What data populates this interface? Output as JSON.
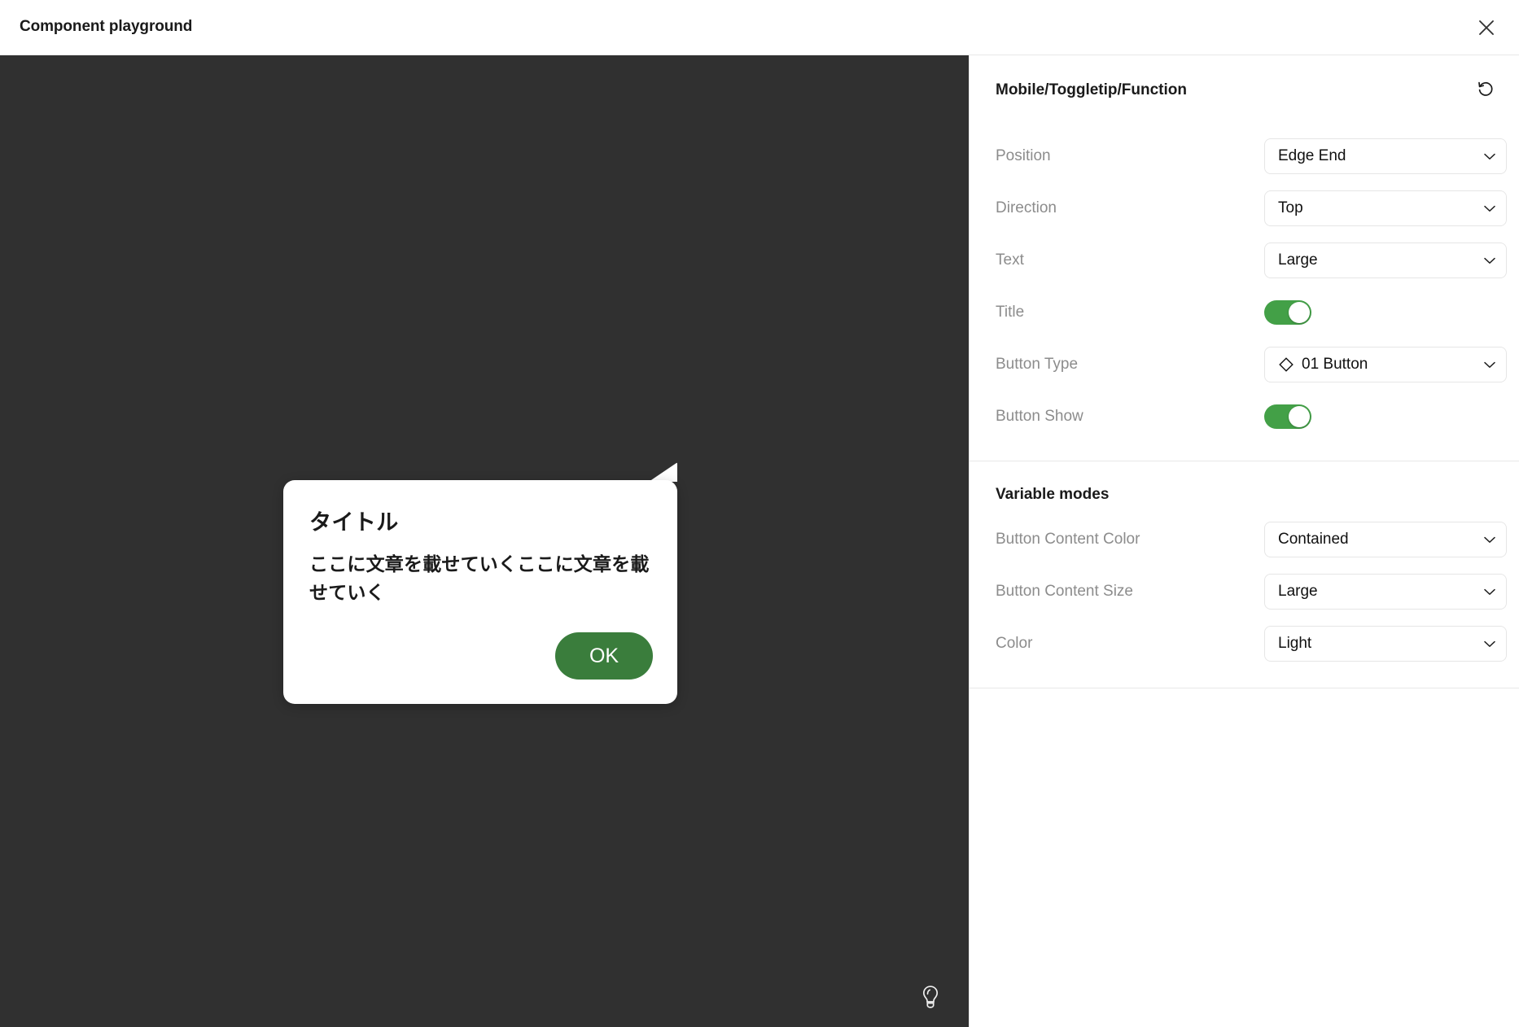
{
  "window": {
    "title": "Component playground",
    "close_icon": "close-icon"
  },
  "canvas": {
    "background_color": "#303030",
    "hint_icon": "lightbulb-icon"
  },
  "tooltip": {
    "component_name": "Mobile/Toggletip/Function",
    "title": "タイトル",
    "body": "ここに文章を載せていくここに文章を載せていく",
    "button_label": "OK",
    "button_color": "#3A7D3C",
    "background_color": "#FFFFFF",
    "tail_direction": "top",
    "tail_position": "edge-end"
  },
  "panel": {
    "title": "Mobile/Toggletip/Function",
    "reset_icon": "reset-icon",
    "properties": [
      {
        "label": "Position",
        "type": "select",
        "value": "Edge End",
        "icon": null
      },
      {
        "label": "Direction",
        "type": "select",
        "value": "Top",
        "icon": null
      },
      {
        "label": "Text",
        "type": "select",
        "value": "Large",
        "icon": null
      },
      {
        "label": "Title",
        "type": "toggle",
        "value": "on"
      },
      {
        "label": "Button Type",
        "type": "select",
        "value": "01 Button",
        "icon": "diamond-icon"
      },
      {
        "label": "Button Show",
        "type": "toggle",
        "value": "on"
      }
    ],
    "variable_modes": {
      "section_title": "Variable modes",
      "properties": [
        {
          "label": "Button Content Color",
          "type": "select",
          "value": "Contained",
          "icon": null
        },
        {
          "label": "Button Content Size",
          "type": "select",
          "value": "Large",
          "icon": null
        },
        {
          "label": "Color",
          "type": "select",
          "value": "Light",
          "icon": null
        }
      ]
    }
  },
  "colors": {
    "toggle_on": "#43A047",
    "accent_green": "#3A7D3C",
    "canvas_dark": "#303030",
    "border": "#E8E8E8",
    "label_gray": "#8C8C8C"
  }
}
